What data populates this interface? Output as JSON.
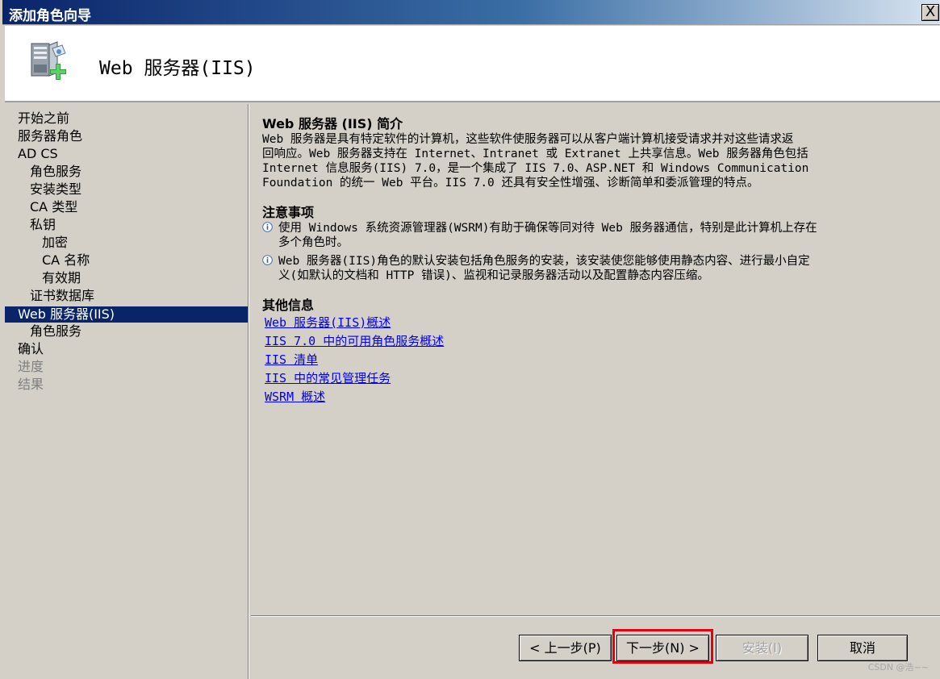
{
  "window": {
    "title": "添加角色向导",
    "close_glyph": "X"
  },
  "header": {
    "title": "Web 服务器(IIS)",
    "icon": "server-add-icon"
  },
  "sidebar": {
    "items": [
      {
        "label": "开始之前",
        "level": 0,
        "state": "normal"
      },
      {
        "label": "服务器角色",
        "level": 0,
        "state": "normal"
      },
      {
        "label": "AD CS",
        "level": 0,
        "state": "normal"
      },
      {
        "label": "角色服务",
        "level": 1,
        "state": "normal"
      },
      {
        "label": "安装类型",
        "level": 1,
        "state": "normal"
      },
      {
        "label": "CA 类型",
        "level": 1,
        "state": "normal"
      },
      {
        "label": "私钥",
        "level": 1,
        "state": "normal"
      },
      {
        "label": "加密",
        "level": 2,
        "state": "normal"
      },
      {
        "label": "CA 名称",
        "level": 2,
        "state": "normal"
      },
      {
        "label": "有效期",
        "level": 2,
        "state": "normal"
      },
      {
        "label": "证书数据库",
        "level": 1,
        "state": "normal"
      },
      {
        "label": "Web 服务器(IIS)",
        "level": 0,
        "state": "selected"
      },
      {
        "label": "角色服务",
        "level": 1,
        "state": "normal"
      },
      {
        "label": "确认",
        "level": 0,
        "state": "normal"
      },
      {
        "label": "进度",
        "level": 0,
        "state": "disabled"
      },
      {
        "label": "结果",
        "level": 0,
        "state": "disabled"
      }
    ]
  },
  "main": {
    "intro_title": "Web 服务器 (IIS) 简介",
    "intro_lines": [
      "Web 服务器是具有特定软件的计算机，这些软件使服务器可以从客户端计算机接受请求并对这些请求返",
      "回响应。Web 服务器支持在 Internet、Intranet 或 Extranet 上共享信息。Web 服务器角色包括",
      "Internet 信息服务(IIS) 7.0，是一个集成了 IIS 7.0、ASP.NET 和 Windows Communication",
      "Foundation 的统一 Web 平台。IIS 7.0 还具有安全性增强、诊断简单和委派管理的特点。"
    ],
    "notes_title": "注意事项",
    "notes": [
      [
        "使用 Windows 系统资源管理器(WSRM)有助于确保等同对待 Web 服务器通信，特别是此计算机上存在",
        "多个角色时。"
      ],
      [
        "Web 服务器(IIS)角色的默认安装包括角色服务的安装，该安装使您能够使用静态内容、进行最小自定",
        "义(如默认的文档和 HTTP 错误)、监视和记录服务器活动以及配置静态内容压缩。"
      ]
    ],
    "more_title": "其他信息",
    "links": [
      "Web 服务器(IIS)概述",
      "IIS 7.0 中的可用角色服务概述",
      "IIS 清单",
      "IIS 中的常见管理任务",
      "WSRM 概述"
    ]
  },
  "buttons": {
    "prev": "< 上一步(P)",
    "next": "下一步(N) >",
    "install": "安装(I)",
    "cancel": "取消"
  },
  "watermark": "CSDN @浩~~"
}
